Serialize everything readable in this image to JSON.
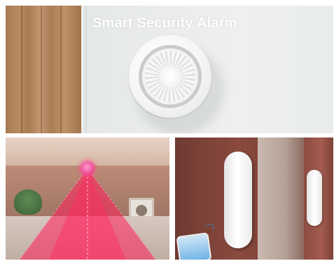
{
  "panels": {
    "top": {
      "title": "Smart Security Alarm",
      "subject": "siren-icon"
    },
    "bottom_left": {
      "subject": "motion-sensor-icon",
      "accent_color": "#e0206e"
    },
    "bottom_right": {
      "subject": "door-sensor-icon",
      "accent_color": "#2d8fe0"
    }
  }
}
